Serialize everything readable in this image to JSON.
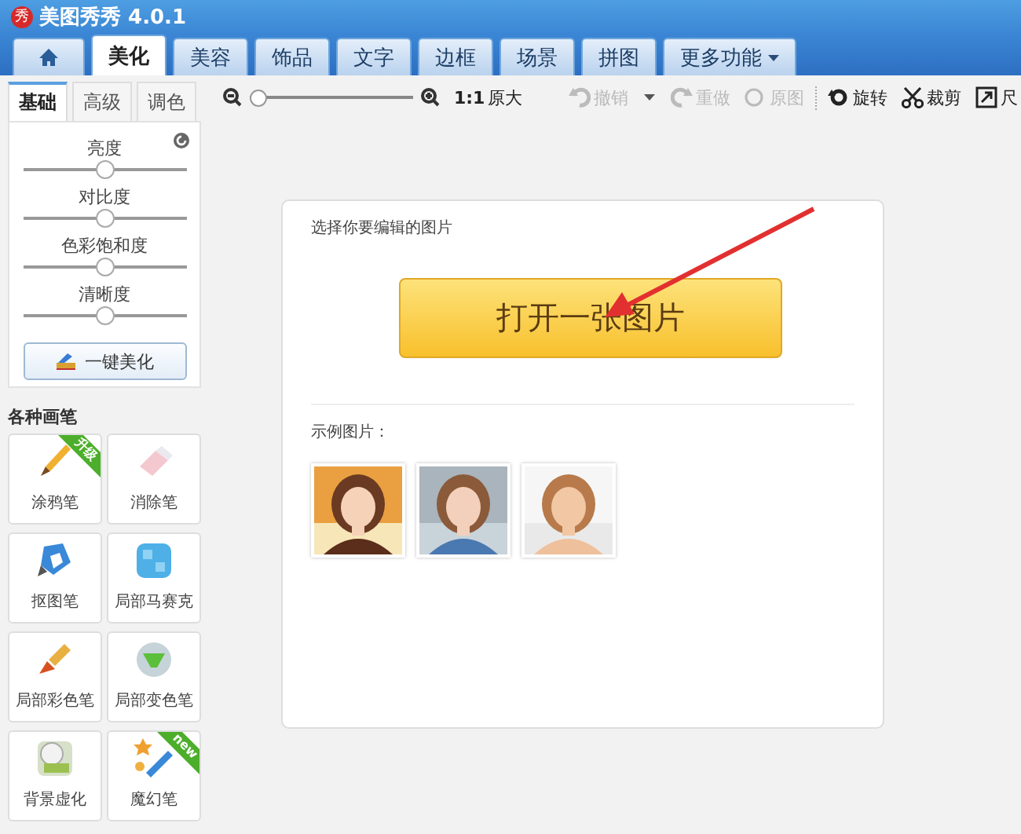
{
  "window": {
    "logo_text": "秀",
    "title": "美图秀秀 4.0.1"
  },
  "tabs": [
    {
      "kind": "home",
      "selected": false
    },
    {
      "label": "美化",
      "selected": true
    },
    {
      "label": "美容",
      "selected": false
    },
    {
      "label": "饰品",
      "selected": false
    },
    {
      "label": "文字",
      "selected": false
    },
    {
      "label": "边框",
      "selected": false
    },
    {
      "label": "场景",
      "selected": false
    },
    {
      "label": "拼图",
      "selected": false
    },
    {
      "label": "更多功能",
      "kind": "menu",
      "selected": false
    }
  ],
  "adjust_panel": {
    "tabs": [
      {
        "label": "基础",
        "selected": true
      },
      {
        "label": "高级",
        "selected": false
      },
      {
        "label": "调色",
        "selected": false
      }
    ],
    "sliders": [
      {
        "label": "亮度",
        "level": 0.5
      },
      {
        "label": "对比度",
        "level": 0.5
      },
      {
        "label": "色彩饱和度",
        "level": 0.5
      },
      {
        "label": "清晰度",
        "level": 0.5
      }
    ],
    "auto_button": "一键美化"
  },
  "brushes": {
    "title": "各种画笔",
    "items": [
      {
        "label": "涂鸦笔",
        "kind": "brush",
        "badge": "升级"
      },
      {
        "label": "消除笔",
        "kind": "eraser"
      },
      {
        "label": "抠图笔",
        "kind": "pen"
      },
      {
        "label": "局部马赛克",
        "kind": "mosaic"
      },
      {
        "label": "局部彩色笔",
        "kind": "paintbrush"
      },
      {
        "label": "局部变色笔",
        "kind": "bucket"
      },
      {
        "label": "背景虚化",
        "kind": "blur"
      },
      {
        "label": "魔幻笔",
        "kind": "magic",
        "badge": "new"
      }
    ]
  },
  "toolbar": {
    "zoom": {
      "level": 0,
      "ratio": "1:1",
      "label": "原大"
    },
    "items": [
      {
        "kind": "undo",
        "label": "撤销",
        "disabled": true
      },
      {
        "kind": "menu",
        "disabled": false
      },
      {
        "kind": "redo",
        "label": "重做",
        "disabled": true
      },
      {
        "kind": "original",
        "label": "原图",
        "disabled": true
      },
      {
        "kind": "separator"
      },
      {
        "kind": "rotate",
        "label": "旋转",
        "disabled": false
      },
      {
        "kind": "crop",
        "label": "裁剪",
        "disabled": false
      },
      {
        "kind": "resize",
        "label": "尺",
        "disabled": false
      }
    ]
  },
  "open_card": {
    "prompt": "选择你要编辑的图片",
    "open_button": "打开一张图片",
    "samples_label": "示例图片："
  }
}
